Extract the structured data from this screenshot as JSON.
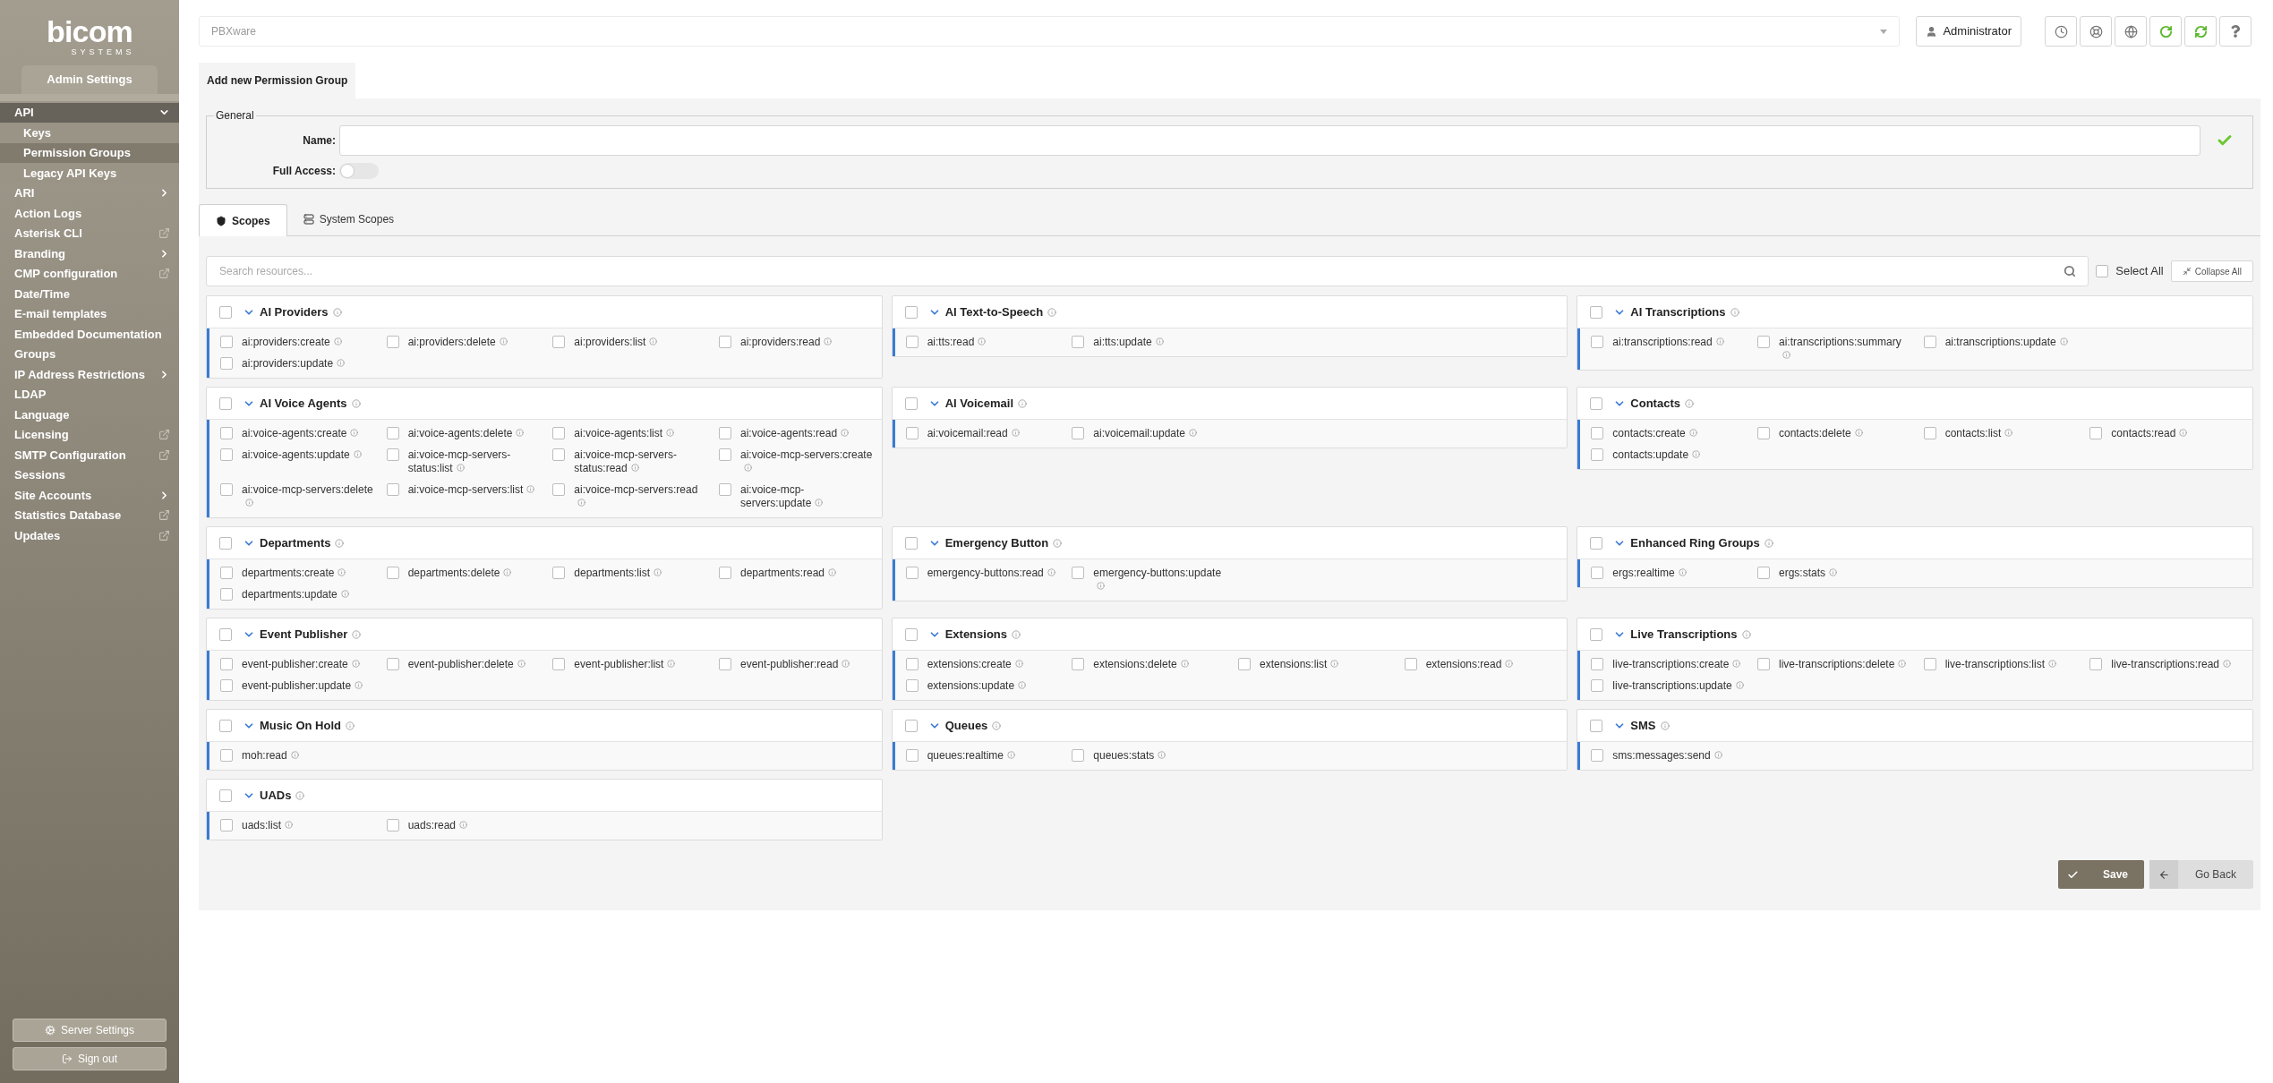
{
  "logo": {
    "name": "bicom",
    "tagline": "SYSTEMS"
  },
  "sidebar": {
    "section_tab": "Admin Settings",
    "items": [
      {
        "label": "API",
        "kind": "expand",
        "expanded": true,
        "selected": true,
        "children": [
          {
            "label": "Keys",
            "selected": false
          },
          {
            "label": "Permission Groups",
            "selected": true
          },
          {
            "label": "Legacy API Keys",
            "selected": false
          }
        ]
      },
      {
        "label": "ARI",
        "kind": "submenu",
        "selected": false
      },
      {
        "label": "Action Logs",
        "kind": "plain",
        "selected": false
      },
      {
        "label": "Asterisk CLI",
        "kind": "external",
        "selected": false
      },
      {
        "label": "Branding",
        "kind": "submenu",
        "selected": false
      },
      {
        "label": "CMP configuration",
        "kind": "external",
        "selected": false
      },
      {
        "label": "Date/Time",
        "kind": "plain",
        "selected": false
      },
      {
        "label": "E-mail templates",
        "kind": "plain",
        "selected": false
      },
      {
        "label": "Embedded Documentation",
        "kind": "plain",
        "selected": false
      },
      {
        "label": "Groups",
        "kind": "plain",
        "selected": false
      },
      {
        "label": "IP Address Restrictions",
        "kind": "submenu",
        "selected": false
      },
      {
        "label": "LDAP",
        "kind": "plain",
        "selected": false
      },
      {
        "label": "Language",
        "kind": "plain",
        "selected": false
      },
      {
        "label": "Licensing",
        "kind": "external",
        "selected": false
      },
      {
        "label": "SMTP Configuration",
        "kind": "external",
        "selected": false
      },
      {
        "label": "Sessions",
        "kind": "plain",
        "selected": false
      },
      {
        "label": "Site Accounts",
        "kind": "submenu",
        "selected": false
      },
      {
        "label": "Statistics Database",
        "kind": "external",
        "selected": false
      },
      {
        "label": "Updates",
        "kind": "external",
        "selected": false
      }
    ],
    "footer_buttons": [
      {
        "label": "Server Settings",
        "kind": "settings"
      },
      {
        "label": "Sign out",
        "kind": "signout"
      }
    ]
  },
  "header": {
    "server_select": "PBXware",
    "user_button": "Administrator"
  },
  "page_tab": "Add new Permission Group",
  "general": {
    "legend": "General",
    "name_label": "Name:",
    "name_valid": true,
    "full_access_label": "Full Access:",
    "full_access_on": false
  },
  "scope_tabs": [
    {
      "label": "Scopes",
      "kind": "shield",
      "selected": true
    },
    {
      "label": "System Scopes",
      "kind": "server",
      "selected": false
    }
  ],
  "search": {
    "placeholder": "Search resources..."
  },
  "select_all": {
    "label": "Select All",
    "checked": false
  },
  "collapse_button": "Collapse All",
  "groups": [
    {
      "title": "AI Providers",
      "checked": false,
      "expanded": true,
      "scopes": [
        {
          "name": "ai:providers:create",
          "checked": false
        },
        {
          "name": "ai:providers:delete",
          "checked": false
        },
        {
          "name": "ai:providers:list",
          "checked": false
        },
        {
          "name": "ai:providers:read",
          "checked": false
        },
        {
          "name": "ai:providers:update",
          "checked": false
        }
      ]
    },
    {
      "title": "AI Text-to-Speech",
      "checked": false,
      "expanded": true,
      "scopes": [
        {
          "name": "ai:tts:read",
          "checked": false
        },
        {
          "name": "ai:tts:update",
          "checked": false
        }
      ]
    },
    {
      "title": "AI Transcriptions",
      "checked": false,
      "expanded": true,
      "scopes": [
        {
          "name": "ai:transcriptions:read",
          "checked": false
        },
        {
          "name": "ai:transcriptions:summary",
          "checked": false
        },
        {
          "name": "ai:transcriptions:update",
          "checked": false
        }
      ]
    },
    {
      "title": "AI Voice Agents",
      "checked": false,
      "expanded": true,
      "scopes": [
        {
          "name": "ai:voice-agents:create",
          "checked": false
        },
        {
          "name": "ai:voice-agents:delete",
          "checked": false
        },
        {
          "name": "ai:voice-agents:list",
          "checked": false
        },
        {
          "name": "ai:voice-agents:read",
          "checked": false
        },
        {
          "name": "ai:voice-agents:update",
          "checked": false
        },
        {
          "name": "ai:voice-mcp-servers-status:list",
          "checked": false
        },
        {
          "name": "ai:voice-mcp-servers-status:read",
          "checked": false
        },
        {
          "name": "ai:voice-mcp-servers:create",
          "checked": false
        },
        {
          "name": "ai:voice-mcp-servers:delete",
          "checked": false
        },
        {
          "name": "ai:voice-mcp-servers:list",
          "checked": false
        },
        {
          "name": "ai:voice-mcp-servers:read",
          "checked": false
        },
        {
          "name": "ai:voice-mcp-servers:update",
          "checked": false
        }
      ]
    },
    {
      "title": "AI Voicemail",
      "checked": false,
      "expanded": true,
      "scopes": [
        {
          "name": "ai:voicemail:read",
          "checked": false
        },
        {
          "name": "ai:voicemail:update",
          "checked": false
        }
      ]
    },
    {
      "title": "Contacts",
      "checked": false,
      "expanded": true,
      "scopes": [
        {
          "name": "contacts:create",
          "checked": false
        },
        {
          "name": "contacts:delete",
          "checked": false
        },
        {
          "name": "contacts:list",
          "checked": false
        },
        {
          "name": "contacts:read",
          "checked": false
        },
        {
          "name": "contacts:update",
          "checked": false
        }
      ]
    },
    {
      "title": "Departments",
      "checked": false,
      "expanded": true,
      "scopes": [
        {
          "name": "departments:create",
          "checked": false
        },
        {
          "name": "departments:delete",
          "checked": false
        },
        {
          "name": "departments:list",
          "checked": false
        },
        {
          "name": "departments:read",
          "checked": false
        },
        {
          "name": "departments:update",
          "checked": false
        }
      ]
    },
    {
      "title": "Emergency Button",
      "checked": false,
      "expanded": true,
      "scopes": [
        {
          "name": "emergency-buttons:read",
          "checked": false
        },
        {
          "name": "emergency-buttons:update",
          "checked": false
        }
      ]
    },
    {
      "title": "Enhanced Ring Groups",
      "checked": false,
      "expanded": true,
      "scopes": [
        {
          "name": "ergs:realtime",
          "checked": false
        },
        {
          "name": "ergs:stats",
          "checked": false
        }
      ]
    },
    {
      "title": "Event Publisher",
      "checked": false,
      "expanded": true,
      "scopes": [
        {
          "name": "event-publisher:create",
          "checked": false
        },
        {
          "name": "event-publisher:delete",
          "checked": false
        },
        {
          "name": "event-publisher:list",
          "checked": false
        },
        {
          "name": "event-publisher:read",
          "checked": false
        },
        {
          "name": "event-publisher:update",
          "checked": false
        }
      ]
    },
    {
      "title": "Extensions",
      "checked": false,
      "expanded": true,
      "scopes": [
        {
          "name": "extensions:create",
          "checked": false
        },
        {
          "name": "extensions:delete",
          "checked": false
        },
        {
          "name": "extensions:list",
          "checked": false
        },
        {
          "name": "extensions:read",
          "checked": false
        },
        {
          "name": "extensions:update",
          "checked": false
        }
      ]
    },
    {
      "title": "Live Transcriptions",
      "checked": false,
      "expanded": true,
      "scopes": [
        {
          "name": "live-transcriptions:create",
          "checked": false
        },
        {
          "name": "live-transcriptions:delete",
          "checked": false
        },
        {
          "name": "live-transcriptions:list",
          "checked": false
        },
        {
          "name": "live-transcriptions:read",
          "checked": false
        },
        {
          "name": "live-transcriptions:update",
          "checked": false
        }
      ]
    },
    {
      "title": "Music On Hold",
      "checked": false,
      "expanded": true,
      "scopes": [
        {
          "name": "moh:read",
          "checked": false
        }
      ]
    },
    {
      "title": "Queues",
      "checked": false,
      "expanded": true,
      "scopes": [
        {
          "name": "queues:realtime",
          "checked": false
        },
        {
          "name": "queues:stats",
          "checked": false
        }
      ]
    },
    {
      "title": "SMS",
      "checked": false,
      "expanded": true,
      "scopes": [
        {
          "name": "sms:messages:send",
          "checked": false
        }
      ]
    },
    {
      "title": "UADs",
      "checked": false,
      "expanded": true,
      "scopes": [
        {
          "name": "uads:list",
          "checked": false
        },
        {
          "name": "uads:read",
          "checked": false
        }
      ]
    }
  ],
  "buttons": {
    "save": "Save",
    "back": "Go Back"
  }
}
